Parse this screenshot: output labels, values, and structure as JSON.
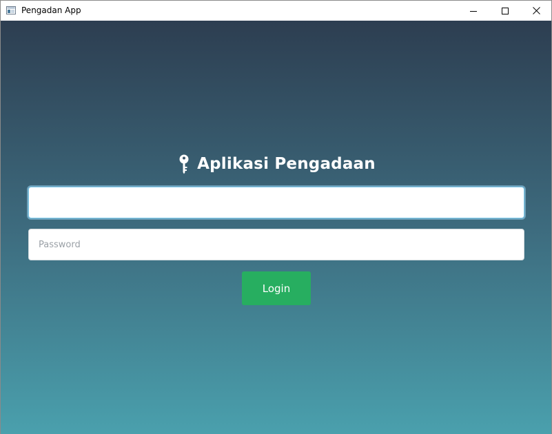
{
  "window": {
    "title": "Pengadan App",
    "icon": "app-window-icon",
    "controls": [
      "minimize-icon",
      "maximize-icon",
      "close-icon"
    ]
  },
  "login": {
    "heading": "Aplikasi Pengadaan",
    "heading_icon": "key-icon",
    "username": {
      "value": "",
      "placeholder": ""
    },
    "password": {
      "value": "",
      "placeholder": "Password"
    },
    "submit_label": "Login"
  },
  "colors": {
    "background_top": "#2d3e51",
    "background_bottom": "#4aa0ad",
    "button": "#27ae60",
    "focus_border": "#7cc8e8"
  }
}
